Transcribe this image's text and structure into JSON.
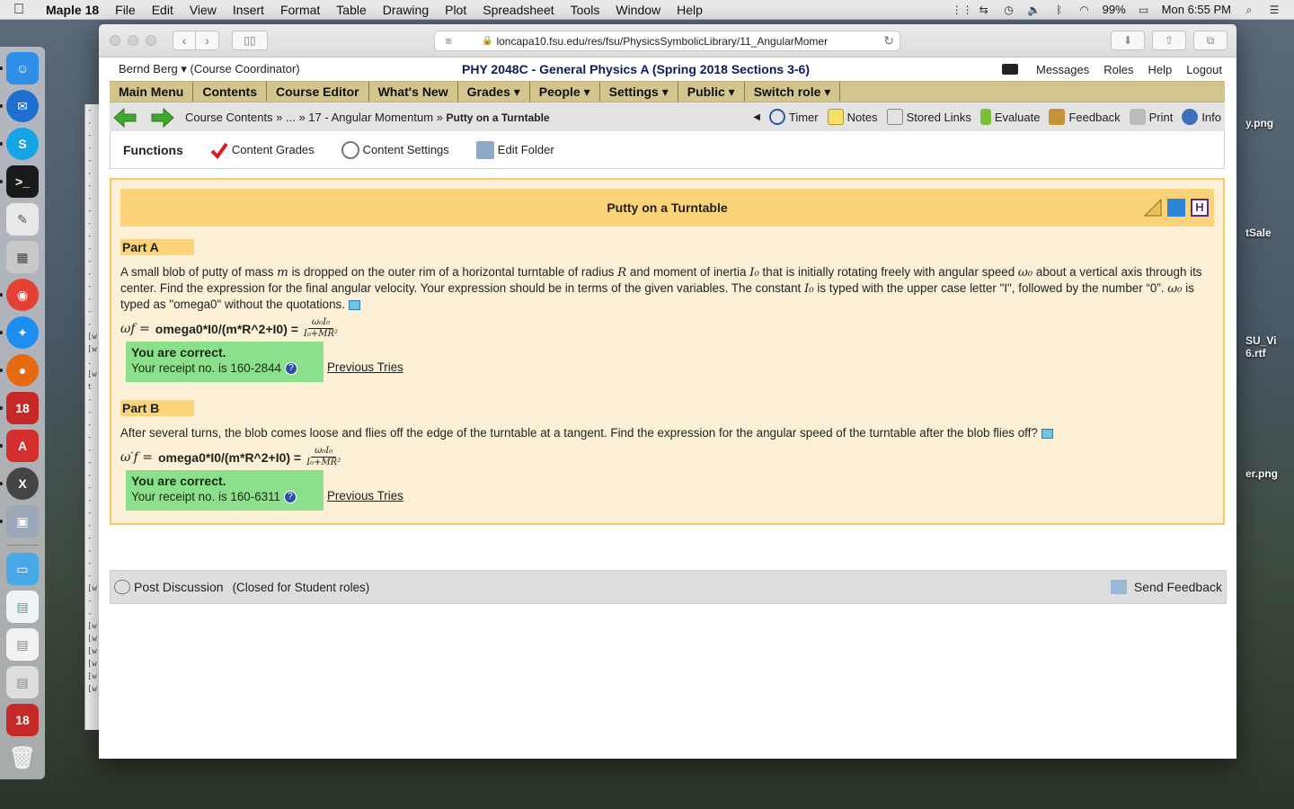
{
  "menubar": {
    "app": "Maple 18",
    "items": [
      "File",
      "Edit",
      "View",
      "Insert",
      "Format",
      "Table",
      "Drawing",
      "Plot",
      "Spreadsheet",
      "Tools",
      "Window",
      "Help"
    ],
    "battery": "99%",
    "clock": "Mon 6:55 PM"
  },
  "browser": {
    "url": "loncapa10.fsu.edu/res/fsu/PhysicsSymbolicLibrary/11_AngularMomer"
  },
  "header": {
    "user": "Bernd Berg ▾ (Course Coordinator)",
    "course": "PHY 2048C - General Physics A (Spring 2018 Sections 3-6)",
    "links": [
      "Messages",
      "Roles",
      "Help",
      "Logout"
    ]
  },
  "mainmenu": [
    "Main Menu",
    "Contents",
    "Course Editor",
    "What's New",
    "Grades ▾",
    "People ▾",
    "Settings ▾",
    "Public ▾",
    "Switch role ▾"
  ],
  "breadcrumb": {
    "trail": "Course Contents » ... » 17 - Angular Momentum » ",
    "current": "Putty on a Turntable"
  },
  "tools": [
    "Timer",
    "Notes",
    "Stored Links",
    "Evaluate",
    "Feedback",
    "Print",
    "Info"
  ],
  "functions": {
    "title": "Functions",
    "items": [
      "Content Grades",
      "Content Settings",
      "Edit Folder"
    ]
  },
  "problem": {
    "title": "Putty on a Turntable",
    "partA": {
      "label": "Part A",
      "text_1": "A small blob of putty of mass ",
      "m": "m",
      "text_2": " is dropped on the outer rim of a horizontal turntable of radius ",
      "R": "R",
      "text_3": " and moment of inertia ",
      "I0": "I₀",
      "text_4": " that is initially rotating freely with angular speed ",
      "w0": "ω₀",
      "text_5": " about a vertical axis through its center. Find the expression for the final angular velocity. Your expression should be in terms of the given variables. The constant ",
      "text_6": " is typed with the upper case letter \"I\", followed by the number “0”. ",
      "text_7": " is typed as \"omega0\" without the quotations.",
      "lhs": "ωf =",
      "expr": "omega0*I0/(m*R^2+I0) =",
      "frac_num": "ω₀I₀",
      "frac_den": "I₀+MR²",
      "correct": "You are correct.",
      "receipt": "Your receipt no. is 160-2844",
      "prev": "Previous Tries"
    },
    "partB": {
      "label": "Part B",
      "text": "After several turns, the blob comes loose and flies off the edge of the turntable at a tangent. Find the expression for the angular speed of the turntable after the blob flies off?",
      "lhs": "ω′f =",
      "expr": "omega0*I0/(m*R^2+I0) =",
      "frac_num": "ω₀I₀",
      "frac_den": "I₀+MR²",
      "correct": "You are correct.",
      "receipt": "Your receipt no. is 160-6311",
      "prev": "Previous Tries"
    }
  },
  "discussion": {
    "post": "Post Discussion",
    "closed": "(Closed for Student roles)",
    "send": "Send Feedback"
  },
  "desktop": {
    "files": [
      "y.png",
      "tSale",
      "SU_Vi",
      "6.rtf",
      "er.png"
    ]
  },
  "colors": {
    "menu_bar": "#d4c48d",
    "problem_bg": "#fcf1d6",
    "problem_title": "#fad37a",
    "correct_green": "#8be08b",
    "course_title": "#0e1b5c"
  }
}
